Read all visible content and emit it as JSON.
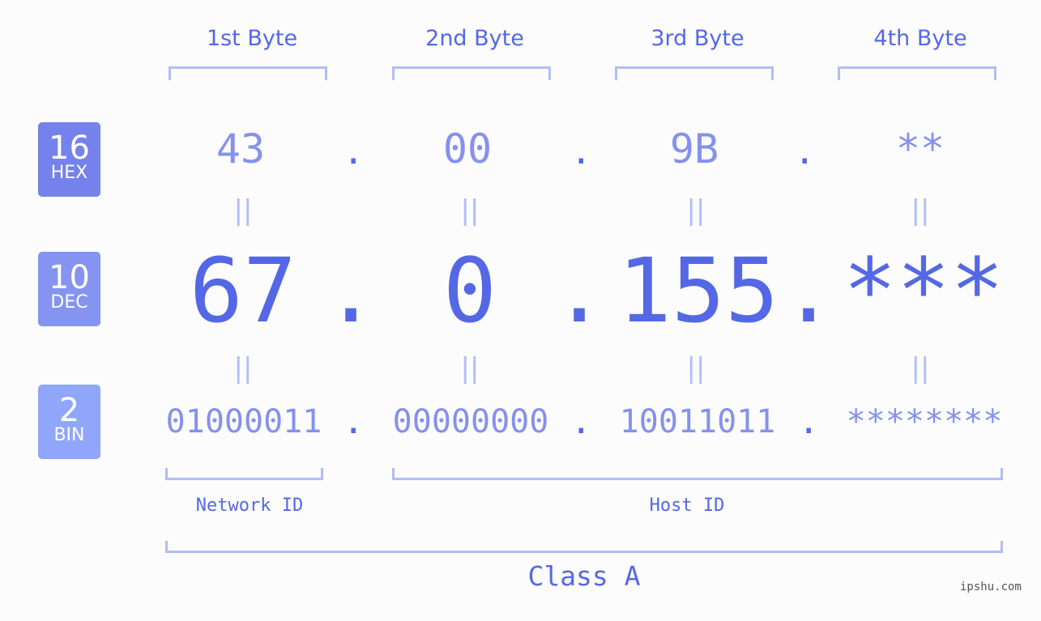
{
  "badges": [
    {
      "num": "16",
      "label": "HEX",
      "color": "#7582ec"
    },
    {
      "num": "10",
      "label": "DEC",
      "color": "#8593f1"
    },
    {
      "num": "2",
      "label": "BIN",
      "color": "#8fa6fa"
    }
  ],
  "byte_headers": [
    "1st Byte",
    "2nd Byte",
    "3rd Byte",
    "4th Byte"
  ],
  "hex": [
    "43",
    "00",
    "9B",
    "**"
  ],
  "dec": [
    "67",
    "0",
    "155",
    "***"
  ],
  "bin": [
    "01000011",
    "00000000",
    "10011011",
    "********"
  ],
  "separator": ".",
  "equals": "||",
  "network_id_label": "Network ID",
  "host_id_label": "Host ID",
  "class_label": "Class A",
  "watermark": "ipshu.com",
  "colors": {
    "accent": "#5468e6",
    "light": "#8591ec",
    "bracket": "#b3bdf6"
  }
}
